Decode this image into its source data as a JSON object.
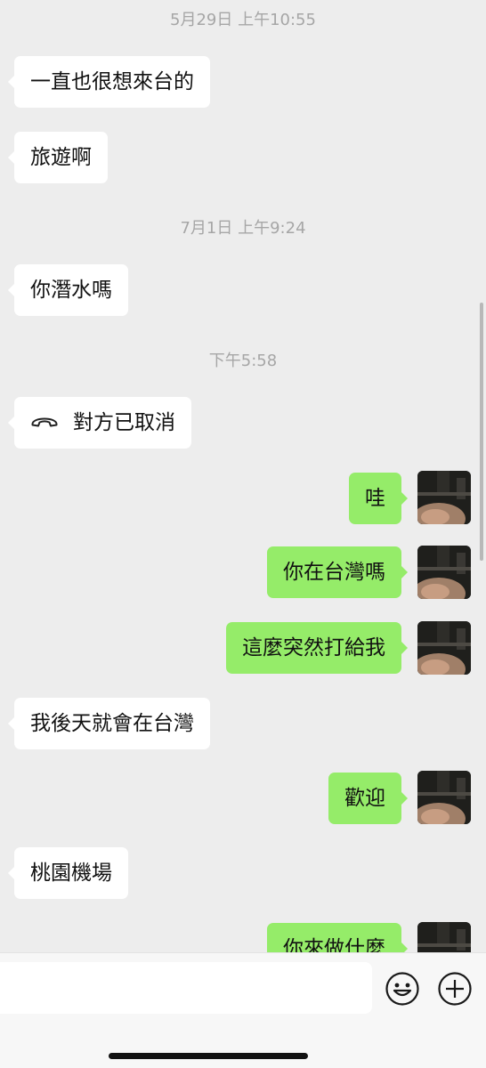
{
  "chat": {
    "timestamps": {
      "t1": "5月29日 上午10:55",
      "t2": "7月1日 上午9:24",
      "t3": "下午5:58"
    },
    "messages": {
      "m1": "一直也很想來台的",
      "m2": "旅遊啊",
      "m3": "你潛水嗎",
      "m4": "對方已取消",
      "m5": "哇",
      "m6": "你在台灣嗎",
      "m7": "這麼突然打給我",
      "m8": "我後天就會在台灣",
      "m9": "歡迎",
      "m10": "桃園機場",
      "m11": "你來做什麼"
    }
  },
  "icons": {
    "call": "phone-hangup-icon",
    "emoji": "emoji-icon",
    "more": "plus-icon"
  },
  "input": {
    "value": "",
    "placeholder": ""
  },
  "colors": {
    "background": "#EDEDED",
    "incoming_bubble": "#FFFFFF",
    "outgoing_bubble": "#95EC69",
    "timestamp_text": "#A6A6A6",
    "input_bar": "#F7F7F7"
  }
}
